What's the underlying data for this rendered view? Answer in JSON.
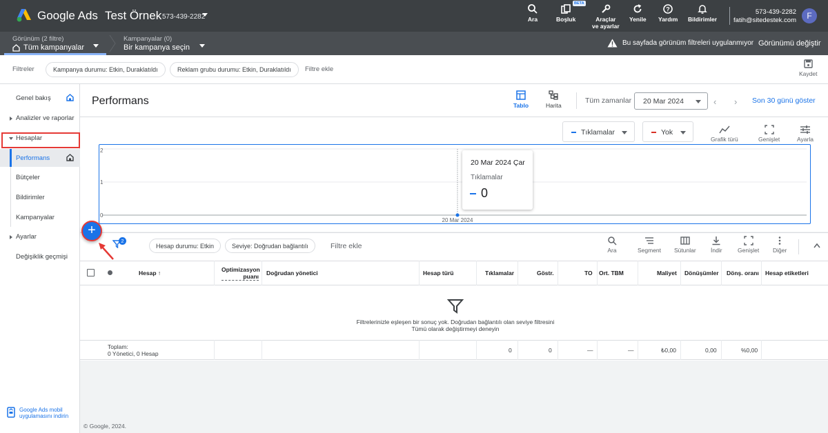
{
  "topbar": {
    "brand": "Google Ads",
    "account_name": "Test Örnek",
    "account_id": "573-439-2282",
    "tools": [
      {
        "label": "Ara",
        "icon": "search-icon"
      },
      {
        "label": "Boşluk",
        "icon": "workspace-icon",
        "badge": "BETA"
      },
      {
        "label": "Araçlar",
        "label2": "ve ayarlar",
        "icon": "wrench-icon"
      },
      {
        "label": "Yenile",
        "icon": "refresh-icon"
      },
      {
        "label": "Yardım",
        "icon": "help-icon"
      },
      {
        "label": "Bildirimler",
        "icon": "bell-icon"
      }
    ],
    "customer_id": "573-439-2282",
    "email": "fatih@sitedestek.com",
    "avatar_letter": "F"
  },
  "viewbar": {
    "view_label": "Görünüm (2 filtre)",
    "view_value": "Tüm kampanyalar",
    "campaigns_label": "Kampanyalar (0)",
    "campaigns_value": "Bir kampanya seçin",
    "warning": "Bu sayfada görünüm filtreleri uygulanmıyor",
    "change_view": "Görünümü değiştir"
  },
  "filterbar": {
    "label": "Filtreler",
    "chips": [
      "Kampanya durumu: Etkin, Duraklatıldı",
      "Reklam grubu durumu: Etkin, Duraklatıldı"
    ],
    "add_filter": "Filtre ekle",
    "save": "Kaydet"
  },
  "sidebar": {
    "items": [
      {
        "label": "Genel bakış"
      },
      {
        "label": "Analizler ve raporlar"
      },
      {
        "label": "Hesaplar"
      },
      {
        "label": "Performans"
      },
      {
        "label": "Bütçeler"
      },
      {
        "label": "Bildirimler"
      },
      {
        "label": "Kampanyalar"
      },
      {
        "label": "Ayarlar"
      },
      {
        "label": "Değişiklik geçmişi"
      }
    ],
    "mobile_promo": "Google Ads mobil uygulamasını indirin"
  },
  "performance": {
    "title": "Performans",
    "view_table": "Tablo",
    "view_map": "Harita",
    "all_time": "Tüm zamanlar",
    "date": "20 Mar 2024",
    "last30": "Son 30 günü göster"
  },
  "chart": {
    "metric1": "Tıklamalar",
    "metric2": "Yok",
    "tools": [
      "Grafik türü",
      "Genişlet",
      "Ayarla"
    ],
    "tooltip_date": "20 Mar 2024 Çar",
    "tooltip_metric": "Tıklamalar",
    "tooltip_value": "0",
    "colors": {
      "metric1": "#1a73e8",
      "metric2": "#d93025"
    }
  },
  "chart_data": {
    "type": "line",
    "x": [
      "20 Mar 2024"
    ],
    "series": [
      {
        "name": "Tıklamalar",
        "values": [
          0
        ]
      }
    ],
    "y_ticks": [
      "0",
      "1",
      "2"
    ],
    "ylim": [
      0,
      2
    ],
    "grid": true
  },
  "table": {
    "filter_count": "2",
    "chips": [
      "Hesap durumu: Etkin",
      "Seviye: Doğrudan bağlantılı"
    ],
    "add_filter": "Filtre ekle",
    "tools": [
      "Ara",
      "Segment",
      "Sütunlar",
      "İndir",
      "Genişlet",
      "Diğer"
    ],
    "columns": [
      "Hesap",
      "Optimizasyon puanı",
      "Doğrudan yönetici",
      "Hesap türü",
      "Tıklamalar",
      "Göstr.",
      "TO",
      "Ort. TBM",
      "Maliyet",
      "Dönüşümler",
      "Dönş. oranı",
      "Hesap etiketleri"
    ],
    "empty_line1": "Filtrelerinizle eşleşen bir sonuç yok. Doğrudan bağlantılı olan seviye filtresini",
    "empty_line2": "Tümü olarak değiştirmeyi deneyin",
    "total_label": "Toplam:",
    "total_sub": "0 Yönetici, 0 Hesap",
    "totals": [
      "0",
      "0",
      "—",
      "—",
      "₺0,00",
      "0,00",
      "%0,00"
    ]
  },
  "footer": "© Google, 2024."
}
